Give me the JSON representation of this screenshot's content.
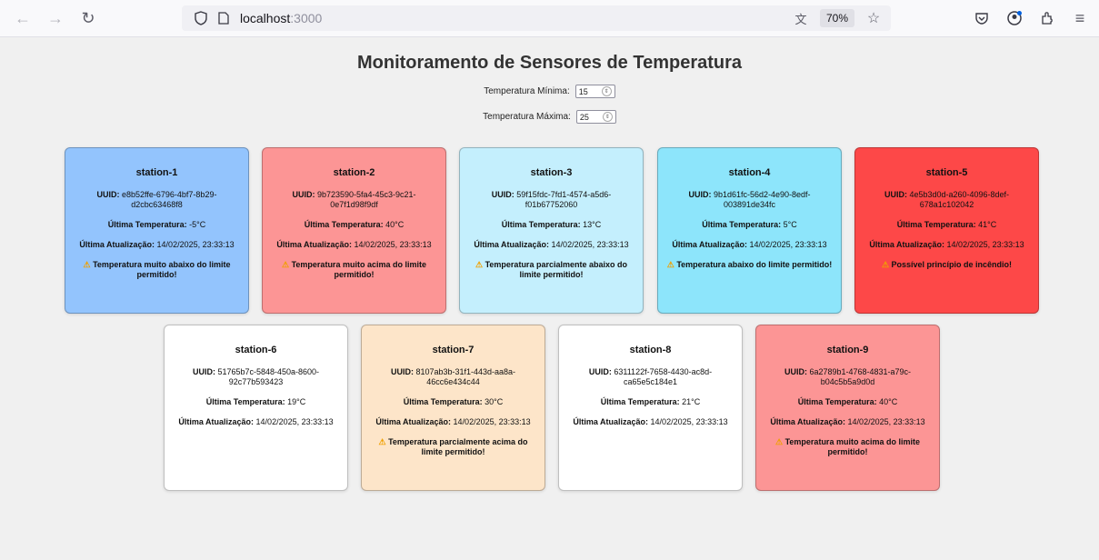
{
  "browser": {
    "url_host": "localhost",
    "url_port": ":3000",
    "zoom": "70%"
  },
  "page": {
    "title": "Monitoramento de Sensores de Temperatura",
    "min_label": "Temperatura Mínima:",
    "min_value": "15",
    "max_label": "Temperatura Máxima:",
    "max_value": "25"
  },
  "labels": {
    "uuid": "UUID:",
    "last_temp": "Última Temperatura:",
    "last_update": "Última Atualização:"
  },
  "stations": [
    {
      "name": "station-1",
      "uuid": "e8b52ffe-6796-4bf7-8b29-d2cbc63468f8",
      "temp": "-5°C",
      "updated": "14/02/2025, 23:33:13",
      "alert": "Temperatura muito abaixo do limite permitido!",
      "color": "#93c4fd"
    },
    {
      "name": "station-2",
      "uuid": "9b723590-5fa4-45c3-9c21-0e7f1d98f9df",
      "temp": "40°C",
      "updated": "14/02/2025, 23:33:13",
      "alert": "Temperatura muito acima do limite permitido!",
      "color": "#fc9595"
    },
    {
      "name": "station-3",
      "uuid": "59f15fdc-7fd1-4574-a5d6-f01b67752060",
      "temp": "13°C",
      "updated": "14/02/2025, 23:33:13",
      "alert": "Temperatura parcialmente abaixo do limite permitido!",
      "color": "#c4effd"
    },
    {
      "name": "station-4",
      "uuid": "9b1d61fc-56d2-4e90-8edf-003891de34fc",
      "temp": "5°C",
      "updated": "14/02/2025, 23:33:13",
      "alert": "Temperatura abaixo do limite permitido!",
      "color": "#8de5fb"
    },
    {
      "name": "station-5",
      "uuid": "4e5b3d0d-a260-4096-8def-678a1c102042",
      "temp": "41°C",
      "updated": "14/02/2025, 23:33:13",
      "alert": "Possível princípio de incêndio!",
      "color": "#fd4848"
    },
    {
      "name": "station-6",
      "uuid": "51765b7c-5848-450a-8600-92c77b593423",
      "temp": "19°C",
      "updated": "14/02/2025, 23:33:13",
      "alert": "",
      "color": "#ffffff"
    },
    {
      "name": "station-7",
      "uuid": "8107ab3b-31f1-443d-aa8a-46cc6e434c44",
      "temp": "30°C",
      "updated": "14/02/2025, 23:33:13",
      "alert": "Temperatura parcialmente acima do limite permitido!",
      "color": "#fde5c9"
    },
    {
      "name": "station-8",
      "uuid": "6311122f-7658-4430-ac8d-ca65e5c184e1",
      "temp": "21°C",
      "updated": "14/02/2025, 23:33:13",
      "alert": "",
      "color": "#ffffff"
    },
    {
      "name": "station-9",
      "uuid": "6a2789b1-4768-4831-a79c-b04c5b5a9d0d",
      "temp": "40°C",
      "updated": "14/02/2025, 23:33:13",
      "alert": "Temperatura muito acima do limite permitido!",
      "color": "#fc9595"
    }
  ]
}
